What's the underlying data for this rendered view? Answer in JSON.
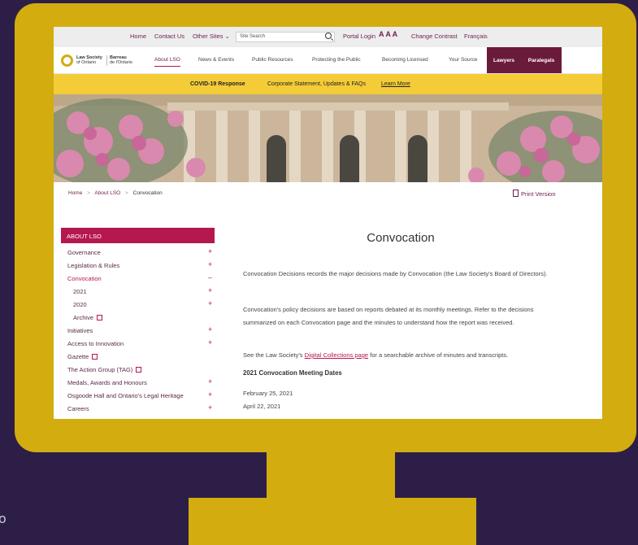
{
  "background_letter": "o",
  "topbar": {
    "home": "Home",
    "contact": "Contact Us",
    "other_sites": "Other Sites",
    "search_placeholder": "Site Search",
    "portal_login": "Portal Login",
    "text_size": "A A A",
    "change_contrast": "Change Contrast",
    "language": "Français"
  },
  "logo": {
    "line1": "Law Society",
    "line2": "of Ontario",
    "line3": "Barreau",
    "line4": "de l'Ontario"
  },
  "nav": {
    "items": [
      "About LSO",
      "News & Events",
      "Public Resources",
      "Protecting the Public",
      "Becoming Licensed",
      "Your Source"
    ],
    "lawyers": "Lawyers",
    "paralegals": "Paralegals"
  },
  "covid": {
    "bold": "COVID-19 Response",
    "text": "Corporate Statement, Updates & FAQs",
    "link": "Learn More"
  },
  "breadcrumb": {
    "home": "Home",
    "sep": ">",
    "about": "About LSO",
    "current": "Convocation"
  },
  "print_version": "Print Version",
  "sidebar": {
    "header": "ABOUT LSO",
    "items": [
      {
        "label": "Governance",
        "toggle": "+"
      },
      {
        "label": "Legislation & Rules",
        "toggle": "+"
      },
      {
        "label": "Convocation",
        "toggle": "–"
      },
      {
        "label": "2021",
        "toggle": "+"
      },
      {
        "label": "2020",
        "toggle": "+"
      },
      {
        "label": "Archive"
      },
      {
        "label": "Initiatives",
        "toggle": "+"
      },
      {
        "label": "Access to Innovation",
        "toggle": "+"
      },
      {
        "label": "Gazette"
      },
      {
        "label": "The Action Group (TAG)"
      },
      {
        "label": "Medals, Awards and Honours",
        "toggle": "+"
      },
      {
        "label": "Osgoode Hall and Ontario's Legal Heritage",
        "toggle": "+"
      },
      {
        "label": "Careers",
        "toggle": "+"
      }
    ]
  },
  "content": {
    "title": "Convocation",
    "p1": "Convocation Decisions records the major decisions made by Convocation (the Law Society's Board of Directors).",
    "p2": "Convocation's policy decisions are based on reports debated at its monthly meetings.  Refer to the decisions summarized on each Convocation page and the minutes to understand how the report was received.",
    "p3_before": "See the Law Society's ",
    "p3_link": "Digital Collections page",
    "p3_after": " for a searchable archive of minutes and transcripts.",
    "subheading": "2021 Convocation Meeting Dates",
    "dates": [
      "February 25, 2021",
      "April 22, 2021"
    ]
  },
  "colors": {
    "frame": "#d3ac0f",
    "background": "#2d1e47",
    "accent": "#b5174f",
    "nav_dark": "#6b1b3a",
    "banner": "#f4cc37"
  }
}
